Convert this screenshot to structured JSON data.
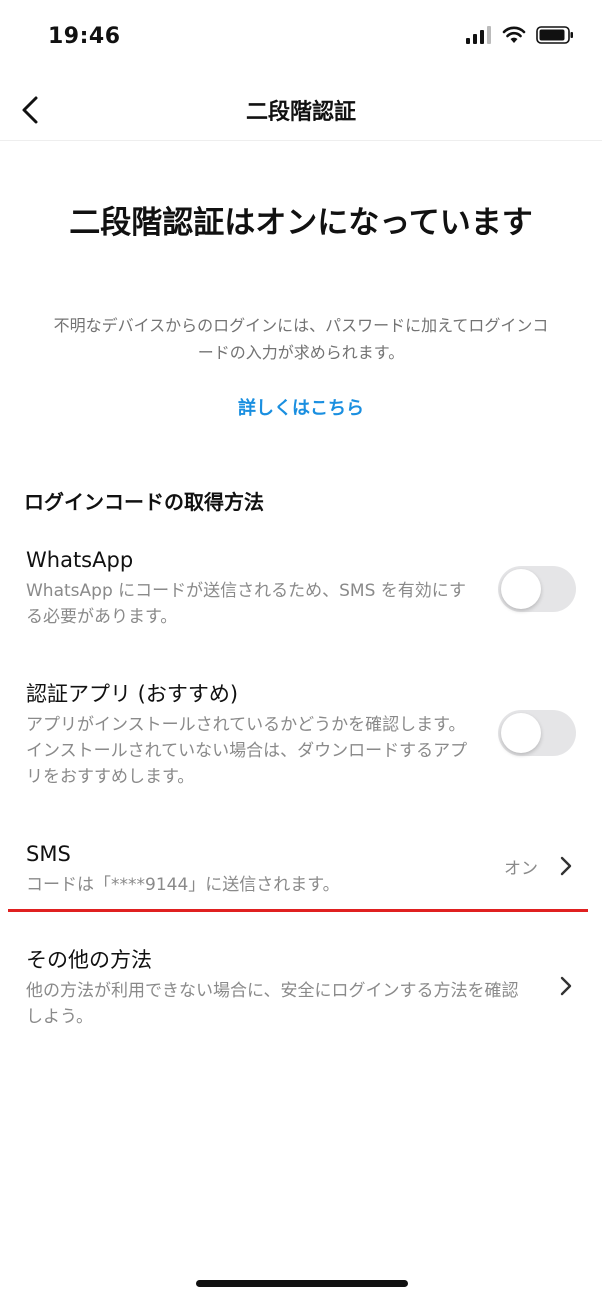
{
  "status_bar": {
    "time": "19:46"
  },
  "nav": {
    "title": "二段階認証"
  },
  "hero": {
    "title": "二段階認証はオンになっています",
    "description": "不明なデバイスからのログインには、パスワードに加えてログインコードの入力が求められます。",
    "learn_more": "詳しくはこちら"
  },
  "section": {
    "heading": "ログインコードの取得方法"
  },
  "options": {
    "whatsapp": {
      "title": "WhatsApp",
      "description": "WhatsApp にコードが送信されるため、SMS を有効にする必要があります。",
      "enabled": false
    },
    "auth_app": {
      "title": "認証アプリ (おすすめ)",
      "description": "アプリがインストールされているかどうかを確認します。インストールされていない場合は、ダウンロードするアプリをおすすめします。",
      "enabled": false
    },
    "sms": {
      "title": "SMS",
      "description": "コードは「****9144」に送信されます。",
      "status": "オン"
    },
    "other": {
      "title": "その他の方法",
      "description": "他の方法が利用できない場合に、安全にログインする方法を確認しよう。"
    }
  },
  "colors": {
    "link": "#1a8fe0",
    "highlight_line": "#e02020",
    "toggle_off": "#e5e5e7",
    "secondary_text": "#8a8a8a"
  }
}
